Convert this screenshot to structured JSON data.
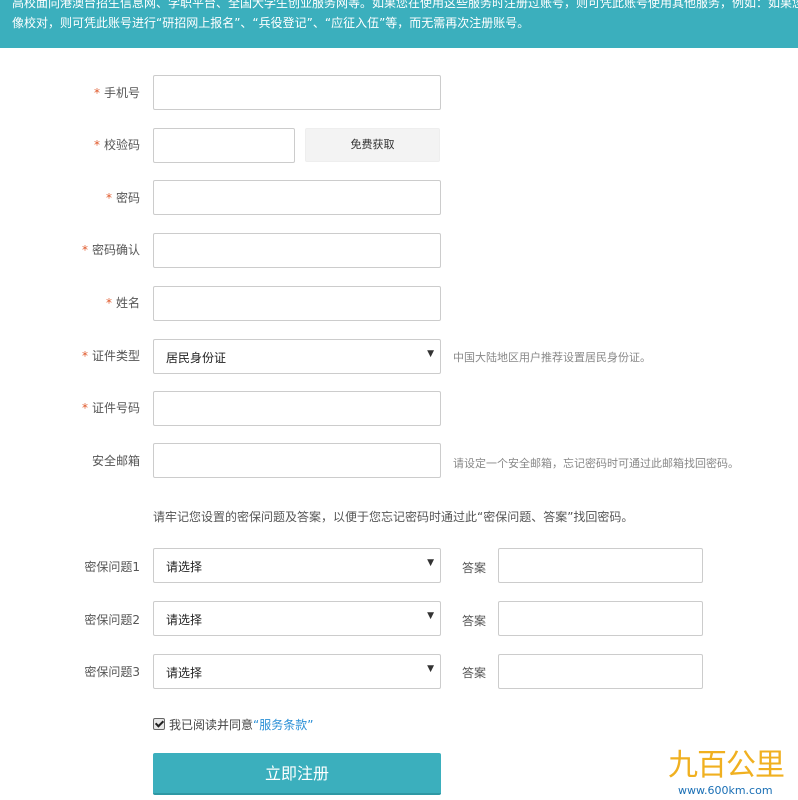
{
  "banner": {
    "line1": "高校面向港澳台招生信息网、学职平台、全国大学生创业服务网等。如果您在使用这些服务时注册过账号，则可凭此账号使用其他服务，例如：如果您",
    "line2": "像校对，则可凭此账号进行“研招网上报名”、“兵役登记”、“应征入伍”等，而无需再次注册账号。"
  },
  "form": {
    "phone_label": "手机号",
    "code_label": "校验码",
    "get_code_button": "免费获取",
    "password_label": "密码",
    "password_confirm_label": "密码确认",
    "name_label": "姓名",
    "id_type_label": "证件类型",
    "id_type_value": "居民身份证",
    "id_type_hint": "中国大陆地区用户推荐设置居民身份证。",
    "id_number_label": "证件号码",
    "email_label": "安全邮箱",
    "email_hint": "请设定一个安全邮箱，忘记密码时可通过此邮箱找回密码。",
    "security_note": "请牢记您设置的密保问题及答案，以便于您忘记密码时通过此“密保问题、答案”找回密码。",
    "questions": [
      {
        "label": "密保问题1",
        "value": "请选择",
        "answer_label": "答案"
      },
      {
        "label": "密保问题2",
        "value": "请选择",
        "answer_label": "答案"
      },
      {
        "label": "密保问题3",
        "value": "请选择",
        "answer_label": "答案"
      }
    ],
    "agree_text": "我已阅读并同意",
    "terms_link": "“服务条款”",
    "submit_button": "立即注册"
  },
  "required_mark": "*",
  "watermark": {
    "text": "九百公里",
    "url": "www.600km.com"
  },
  "colors": {
    "accent": "#3bafbd",
    "required": "#e0582a",
    "link": "#2a8fd6"
  }
}
